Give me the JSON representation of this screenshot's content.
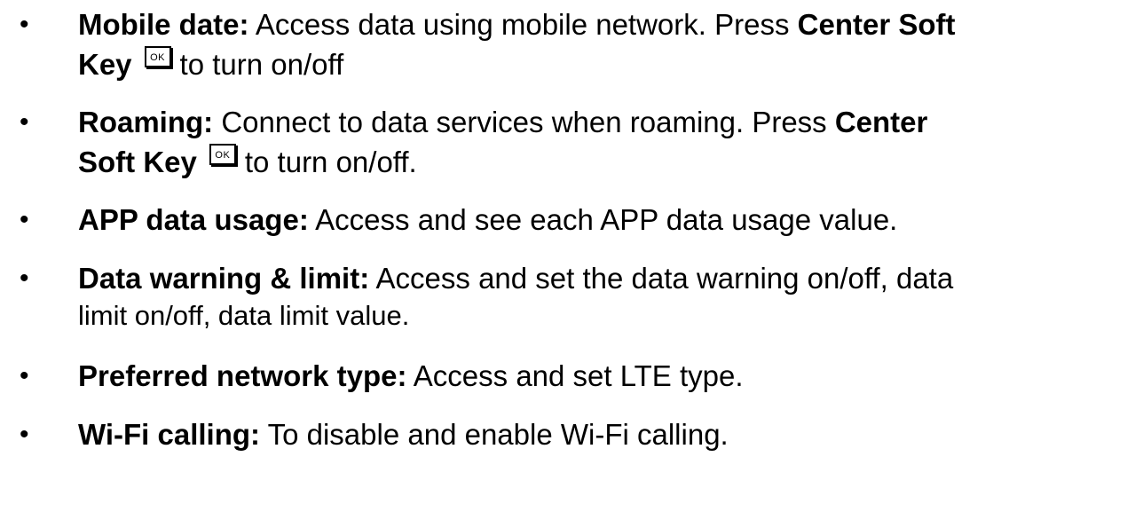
{
  "items": [
    {
      "bullet": "•",
      "term": "Mobile date:",
      "line1_text": " Access data using mobile network. Press ",
      "line1_bold_end": "Center Soft",
      "line2_bold": "Key",
      "key_label": "OK",
      "line2_text": "to turn on/off"
    },
    {
      "bullet": "•",
      "term": "Roaming:",
      "line1_text": " Connect to data services when roaming. Press ",
      "line1_bold_end": "Center",
      "line2_bold": "Soft Key",
      "key_label": "OK",
      "line2_text": "to turn on/off."
    },
    {
      "bullet": "•",
      "term": "APP data usage:",
      "text": " Access and see each APP data usage value."
    },
    {
      "bullet": "•",
      "term": "Data warning & limit:",
      "line1_text": " Access and set the data warning on/off, data",
      "line2_text": "limit on/off, data limit value."
    },
    {
      "bullet": "•",
      "term": "Preferred network type:",
      "text": " Access and set LTE type."
    },
    {
      "bullet": "•",
      "term": "Wi-Fi calling:",
      "text": " To disable and enable Wi-Fi calling."
    }
  ]
}
